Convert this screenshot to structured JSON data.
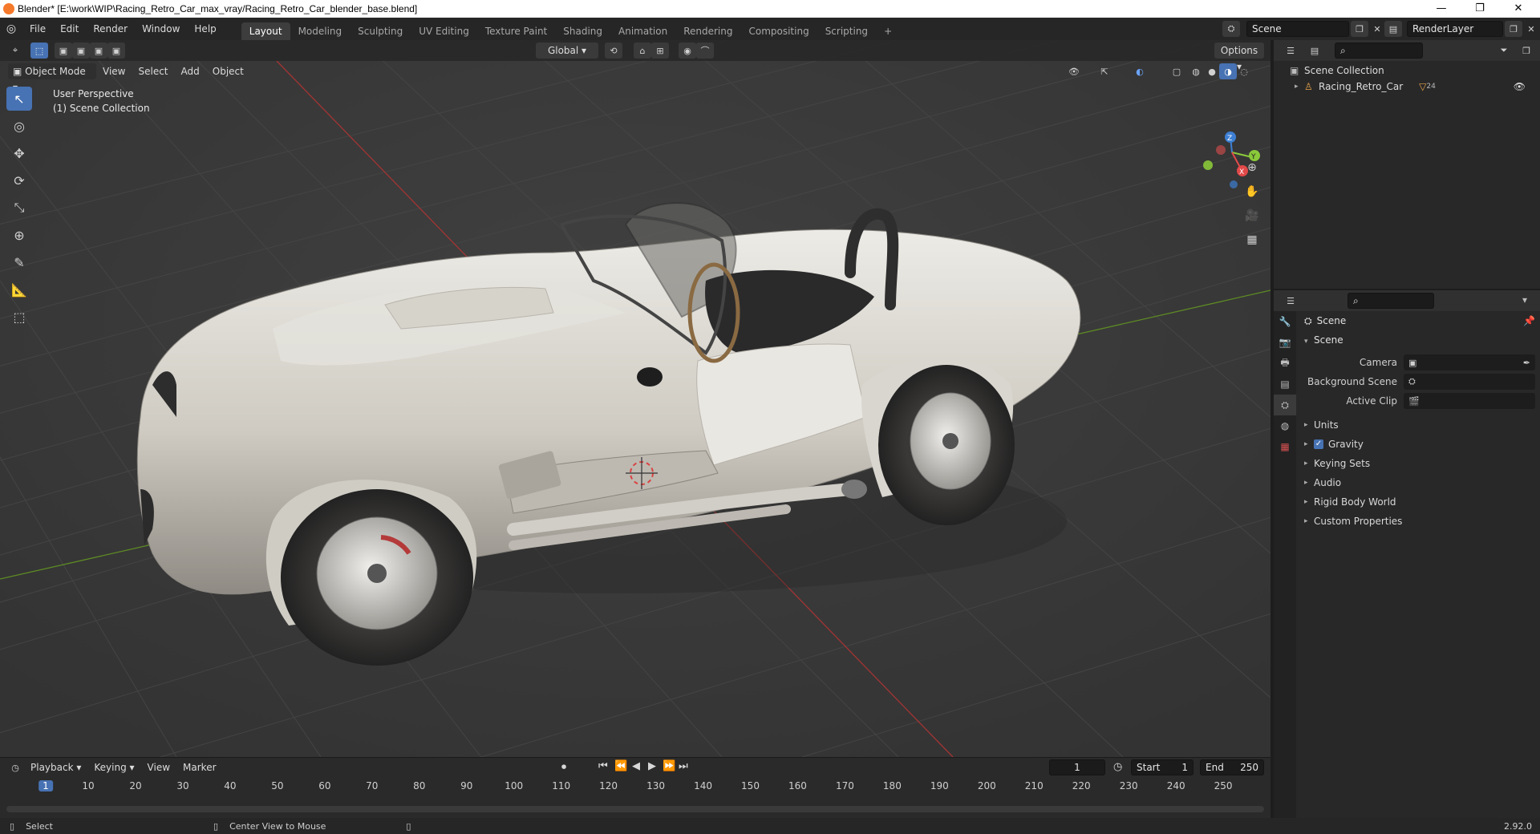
{
  "window": {
    "title": "Blender* [E:\\work\\WIP\\Racing_Retro_Car_max_vray/Racing_Retro_Car_blender_base.blend]",
    "minimize": "—",
    "restore": "❐",
    "close": "✕"
  },
  "menu": [
    "File",
    "Edit",
    "Render",
    "Window",
    "Help"
  ],
  "workspaces": [
    "Layout",
    "Modeling",
    "Sculpting",
    "UV Editing",
    "Texture Paint",
    "Shading",
    "Animation",
    "Rendering",
    "Compositing",
    "Scripting"
  ],
  "workspace_add": "+",
  "scene_field": "Scene",
  "view_layer_field": "RenderLayer",
  "viewport": {
    "transform_orientation": "Global",
    "options_label": "Options",
    "mode": "Object Mode",
    "menus": [
      "View",
      "Select",
      "Add",
      "Object"
    ],
    "overlay_line1": "User Perspective",
    "overlay_line2": "(1) Scene Collection",
    "gizmo": {
      "z": "Z",
      "y": "Y",
      "x": "X"
    }
  },
  "timeline": {
    "menus": [
      "Playback",
      "Keying",
      "View",
      "Marker"
    ],
    "current_frame": "1",
    "start_label": "Start",
    "start_value": "1",
    "end_label": "End",
    "end_value": "250",
    "ticks": [
      "1",
      "10",
      "20",
      "30",
      "40",
      "50",
      "60",
      "70",
      "80",
      "90",
      "100",
      "110",
      "120",
      "130",
      "140",
      "150",
      "160",
      "170",
      "180",
      "190",
      "200",
      "210",
      "220",
      "230",
      "240",
      "250"
    ]
  },
  "status": {
    "select": "Select",
    "center_view": "Center View to Mouse",
    "version": "2.92.0"
  },
  "outliner": {
    "collection": "Scene Collection",
    "object": "Racing_Retro_Car",
    "object_count": "24"
  },
  "properties": {
    "context": "Scene",
    "panel": "Scene",
    "camera_label": "Camera",
    "background_scene_label": "Background Scene",
    "active_clip_label": "Active Clip",
    "subpanels": [
      "Units",
      "Gravity",
      "Keying Sets",
      "Audio",
      "Rigid Body World",
      "Custom Properties"
    ]
  },
  "colors": {
    "accent": "#4772b3",
    "car_body": "#d8d5cc",
    "grid_bg": "#393939",
    "x_axis": "#c0392b",
    "y_axis": "#6f9a2a"
  }
}
